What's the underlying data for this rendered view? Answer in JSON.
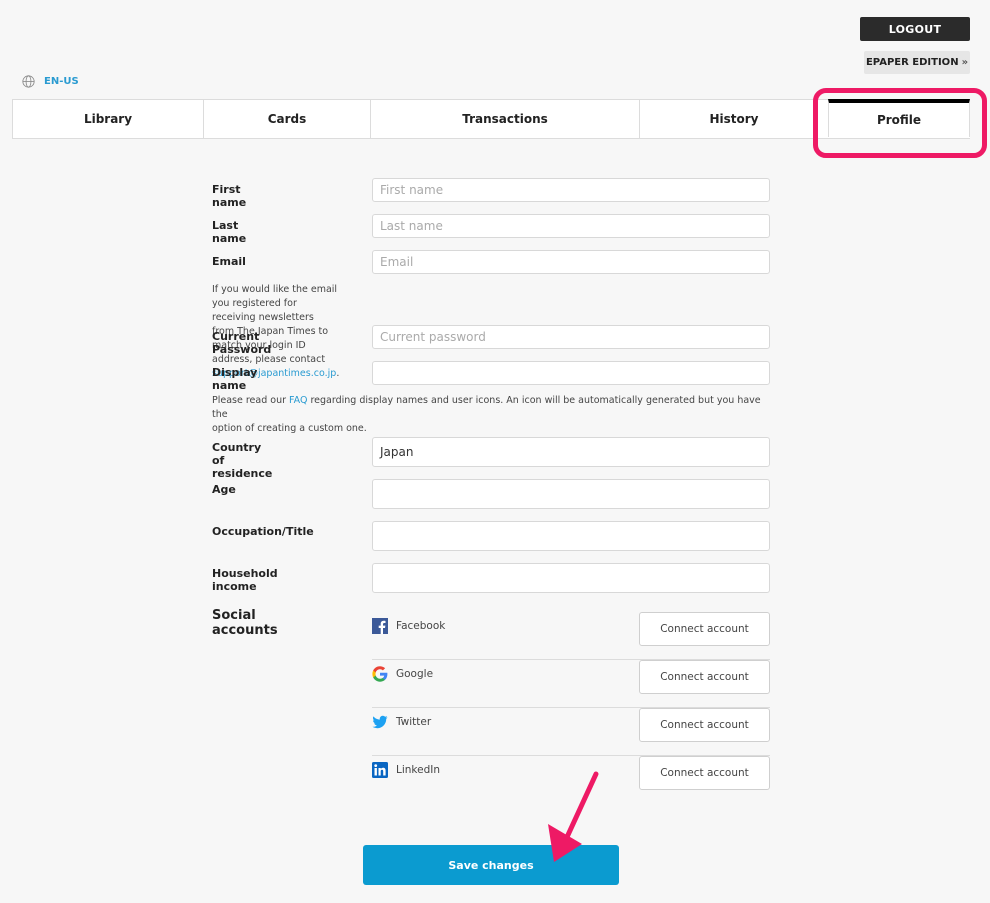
{
  "header": {
    "logout_label": "LOGOUT",
    "epaper_label": "EPAPER EDITION",
    "epaper_arrow": "»",
    "language": "EN-US"
  },
  "tabs": [
    {
      "label": "Library"
    },
    {
      "label": "Cards"
    },
    {
      "label": "Transactions"
    },
    {
      "label": "History"
    },
    {
      "label": "Profile",
      "active": true
    }
  ],
  "form": {
    "first_name": {
      "label": "First name",
      "placeholder": "First name",
      "value": ""
    },
    "last_name": {
      "label": "Last name",
      "placeholder": "Last name",
      "value": ""
    },
    "email": {
      "label": "Email",
      "placeholder": "Email",
      "value": ""
    },
    "email_note_line1": "If you would like the email you registered for receiving newsletters",
    "email_note_line2_prefix": "from The Japan Times to match your login ID address, please contact ",
    "email_note_link": "support@japantimes.co.jp",
    "email_note_suffix": ".",
    "current_password": {
      "label": "Current Password",
      "placeholder": "Current password",
      "value": ""
    },
    "display_name": {
      "label": "Display name",
      "placeholder": "",
      "value": ""
    },
    "display_note_prefix": "Please read our ",
    "display_note_link": "FAQ",
    "display_note_line1_rest": " regarding display names and user icons. An icon will be automatically generated but you have the",
    "display_note_line2": "option of creating a custom one.",
    "country": {
      "label": "Country of residence",
      "value": "Japan"
    },
    "age": {
      "label": "Age",
      "value": ""
    },
    "occupation": {
      "label": "Occupation/Title",
      "value": ""
    },
    "income": {
      "label": "Household income",
      "value": ""
    }
  },
  "social": {
    "title": "Social accounts",
    "accounts": [
      {
        "name": "Facebook",
        "icon": "facebook-icon",
        "button": "Connect account"
      },
      {
        "name": "Google",
        "icon": "google-icon",
        "button": "Connect account"
      },
      {
        "name": "Twitter",
        "icon": "twitter-icon",
        "button": "Connect account"
      },
      {
        "name": "LinkedIn",
        "icon": "linkedin-icon",
        "button": "Connect account"
      }
    ]
  },
  "save_label": "Save changes",
  "colors": {
    "accent": "#0b9bd0",
    "link": "#2a9bd1",
    "highlight": "#ee1a65",
    "dark_button": "#2b2b2b"
  }
}
